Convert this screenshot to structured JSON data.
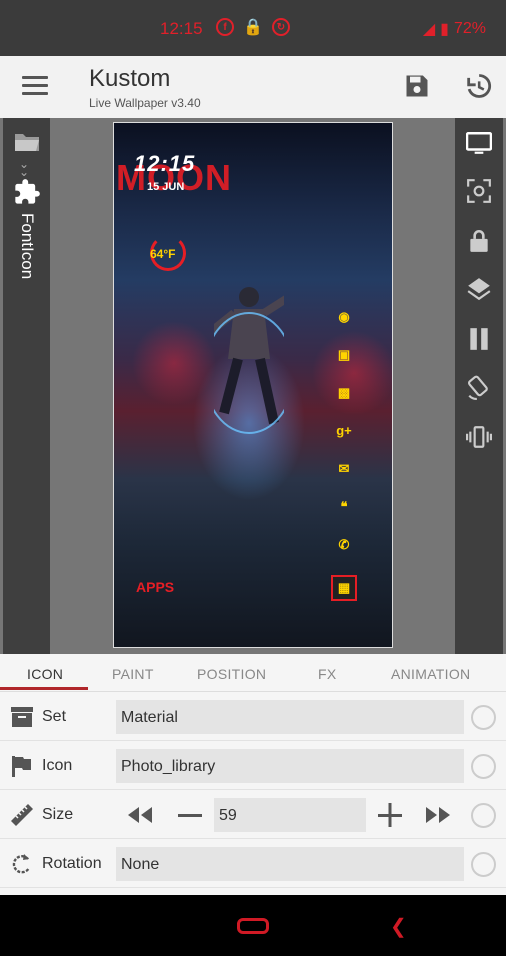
{
  "status_bar": {
    "time": "12:15",
    "battery": "72%",
    "accent_color": "#e0202a"
  },
  "app_bar": {
    "title": "Kustom",
    "subtitle": "Live Wallpaper v3.40",
    "icons": [
      "menu-icon",
      "save-icon",
      "history-icon"
    ]
  },
  "left_rail": {
    "label": "FontIcon",
    "icons": [
      "folder-icon",
      "chevron-down-icon",
      "puzzle-icon"
    ]
  },
  "right_rail": {
    "icons": [
      "screen-icon",
      "focus-icon",
      "lock-icon",
      "layers-icon",
      "pause-icon",
      "rotate-icon",
      "vibrate-icon"
    ]
  },
  "preview": {
    "time": "12:15",
    "big_text": "MOON",
    "date": "15 JUN",
    "temperature": "64°F",
    "apps_label": "APPS",
    "dock_icons": [
      "headset-icon",
      "camera-icon",
      "chat-icon",
      "google-plus-icon",
      "mail-icon",
      "hangouts-icon",
      "phone-icon",
      "photo-library-icon"
    ]
  },
  "tabs": [
    {
      "label": "ICON",
      "active": true
    },
    {
      "label": "PAINT",
      "active": false
    },
    {
      "label": "POSITION",
      "active": false
    },
    {
      "label": "FX",
      "active": false
    },
    {
      "label": "ANIMATION",
      "active": false
    }
  ],
  "properties": {
    "set": {
      "label": "Set",
      "value": "Material",
      "icon": "archive-icon"
    },
    "icon": {
      "label": "Icon",
      "value": "Photo_library",
      "icon": "flag-icon"
    },
    "size": {
      "label": "Size",
      "value": "59",
      "icon": "ruler-icon"
    },
    "rotation": {
      "label": "Rotation",
      "value": "None",
      "icon": "rotate-icon"
    }
  },
  "nav_bar": {
    "color": "#d01a25"
  }
}
